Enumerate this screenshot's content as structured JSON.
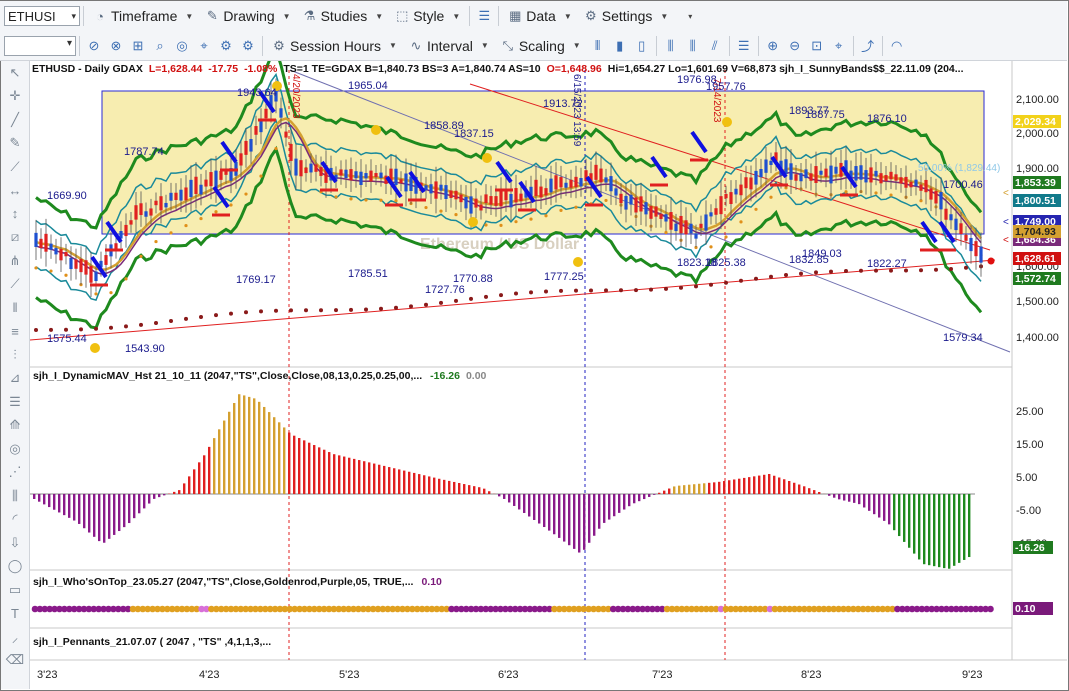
{
  "toolbar": {
    "symbol": "ETHUSI",
    "menus": {
      "timeframe": "Timeframe",
      "drawing": "Drawing",
      "studies": "Studies",
      "style": "Style",
      "data": "Data",
      "settings": "Settings",
      "session_hours": "Session Hours",
      "interval": "Interval",
      "scaling": "Scaling"
    }
  },
  "price_pane": {
    "header": {
      "symbol": "ETHUSD - Daily  GDAX",
      "last": "L=1,628.44",
      "change": "-17.75",
      "change_pct": "-1.08%",
      "params": "TS=1  TE=GDAX  B=1,840.73  BS=3  A=1,840.74  AS=10",
      "open": "O=1,648.96",
      "rest": "Hi=1,654.27  Lo=1,601.69  V=68,873  sjh_I_SunnyBands$$_22.11.09 (204..."
    },
    "price_ticks": [
      "2,100.00",
      "2,000.00",
      "1,900.00",
      "1,600.00",
      "1,500.00",
      "1,400.00"
    ],
    "tags": {
      "t2029": "2,029.34",
      "t1853": "1,853.39",
      "t1800": "1,800.51",
      "t1749": "1,749.00",
      "t1704": "1,704.93",
      "t1684": "1,684.36",
      "t1628": "1,628.61",
      "t1572": "1,572.74"
    },
    "fib_label": "50.00% (1,829.44)",
    "watermark": "Ethereum / US Dollar",
    "annotations": {
      "a1": "1943.64",
      "a2": "1965.04",
      "a3": "1787.74",
      "a4": "1669.90",
      "a5": "1575.44",
      "a6": "1543.90",
      "a7": "1858.89",
      "a8": "1837.15",
      "a9": "1913.72",
      "a10": "1976.98",
      "a11": "1957.76",
      "a12": "1893.77",
      "a13": "1887.75",
      "a14": "1876.10",
      "a15": "1769.17",
      "a16": "1785.51",
      "a17": "1770.88",
      "a18": "1727.76",
      "a19": "1777.25",
      "a20": "1823.18",
      "a21": "1825.38",
      "a22": "1849.03",
      "a23": "1832.85",
      "a24": "1822.27",
      "a25": "1700.46",
      "a26": "1579.34"
    },
    "vlabels": {
      "v1": "4/20/2023",
      "v2": "6/15/2023 13:59",
      "v3": "7/14/2023"
    }
  },
  "mav_pane": {
    "title": "sjh_I_DynamicMAV_Hst 21_10_11 (2047,\"TS\",Close,Close,08,13,0.25,0.25,00,...",
    "v1": "-16.26",
    "v2": "0.00",
    "ticks": [
      "25.00",
      "15.00",
      "5.00",
      "-5.00",
      "-15.00"
    ],
    "tag": "-16.26"
  },
  "wot_pane": {
    "title": "sjh_I_Who'sOnTop_23.05.27 (2047,\"TS\",Close,Goldenrod,Purple,05,  TRUE,...",
    "value": "0.10",
    "tag": "0.10"
  },
  "pen_pane": {
    "title": "sjh_I_Pennants_21.07.07 ( 2047 , \"TS\" ,4,1,1,3,..."
  },
  "time_axis": [
    "3'23",
    "4'23",
    "5'23",
    "6'23",
    "7'23",
    "8'23",
    "9'23"
  ]
}
